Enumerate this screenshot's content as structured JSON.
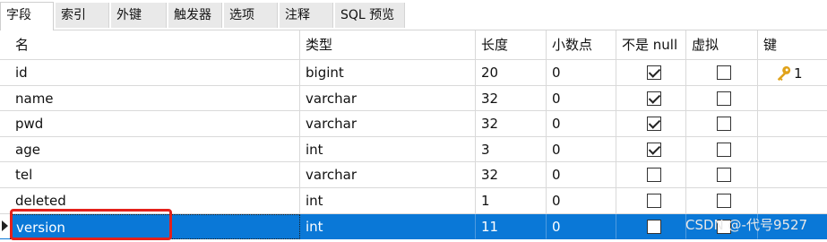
{
  "tabs": [
    {
      "label": "字段",
      "active": true
    },
    {
      "label": "索引",
      "active": false
    },
    {
      "label": "外键",
      "active": false
    },
    {
      "label": "触发器",
      "active": false
    },
    {
      "label": "选项",
      "active": false
    },
    {
      "label": "注释",
      "active": false
    },
    {
      "label": "SQL 预览",
      "active": false
    }
  ],
  "columns": [
    "名",
    "类型",
    "长度",
    "小数点",
    "不是 null",
    "虚拟",
    "键"
  ],
  "rows": [
    {
      "name": "id",
      "type": "bigint",
      "length": "20",
      "decimals": "0",
      "not_null": true,
      "virtual": false,
      "key": "1",
      "selected": false
    },
    {
      "name": "name",
      "type": "varchar",
      "length": "32",
      "decimals": "0",
      "not_null": true,
      "virtual": false,
      "key": "",
      "selected": false
    },
    {
      "name": "pwd",
      "type": "varchar",
      "length": "32",
      "decimals": "0",
      "not_null": true,
      "virtual": false,
      "key": "",
      "selected": false
    },
    {
      "name": "age",
      "type": "int",
      "length": "3",
      "decimals": "0",
      "not_null": true,
      "virtual": false,
      "key": "",
      "selected": false
    },
    {
      "name": "tel",
      "type": "varchar",
      "length": "32",
      "decimals": "0",
      "not_null": false,
      "virtual": false,
      "key": "",
      "selected": false
    },
    {
      "name": "deleted",
      "type": "int",
      "length": "1",
      "decimals": "0",
      "not_null": false,
      "virtual": false,
      "key": "",
      "selected": false
    },
    {
      "name": "version",
      "type": "int",
      "length": "11",
      "decimals": "0",
      "not_null": false,
      "virtual": false,
      "key": "",
      "selected": true
    }
  ],
  "watermark": "CSDN @-代号9527",
  "colors": {
    "selection": "#0a78d7",
    "highlight_box": "#e4211b",
    "key_icon": "#e0a21a"
  }
}
